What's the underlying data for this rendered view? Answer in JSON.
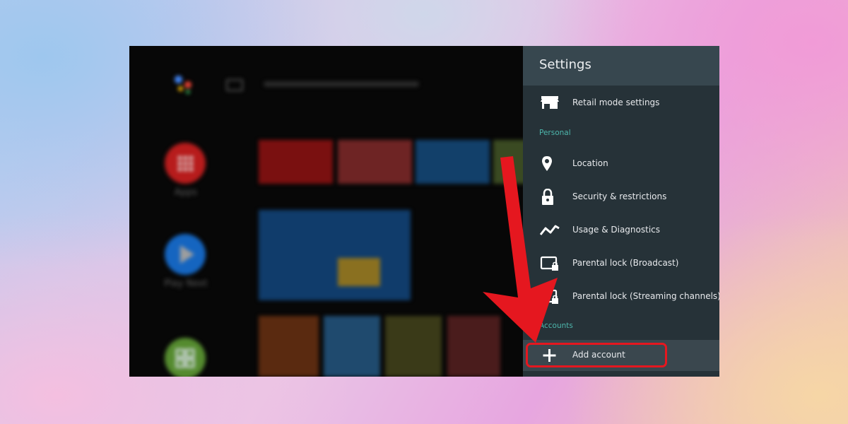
{
  "home": {
    "side": [
      {
        "label": "Apps",
        "icon": "apps-grid-icon",
        "color": "#c62828"
      },
      {
        "label": "Play Next",
        "icon": "play-icon",
        "color": "#1e88e5"
      },
      {
        "label": "",
        "icon": "widgets-icon",
        "color": "#7cb342"
      }
    ]
  },
  "settings": {
    "title": "Settings",
    "items": [
      {
        "label": "Retail mode settings",
        "icon": "store-icon"
      },
      {
        "label": "Location",
        "icon": "location-pin-icon"
      },
      {
        "label": "Security & restrictions",
        "icon": "lock-icon"
      },
      {
        "label": "Usage & Diagnostics",
        "icon": "trend-line-icon"
      },
      {
        "label": "Parental lock (Broadcast)",
        "icon": "tv-lock-icon"
      },
      {
        "label": "Parental lock (Streaming channels)",
        "icon": "tv-lock-icon"
      }
    ],
    "sections": {
      "personal": "Personal",
      "accounts": "Accounts"
    },
    "add_account": {
      "label": "Add account",
      "icon": "plus-icon"
    }
  },
  "colors": {
    "panel_bg": "#263238",
    "panel_header": "#37474f",
    "section_text": "#4db6ac",
    "annotation_red": "#e5171f"
  }
}
